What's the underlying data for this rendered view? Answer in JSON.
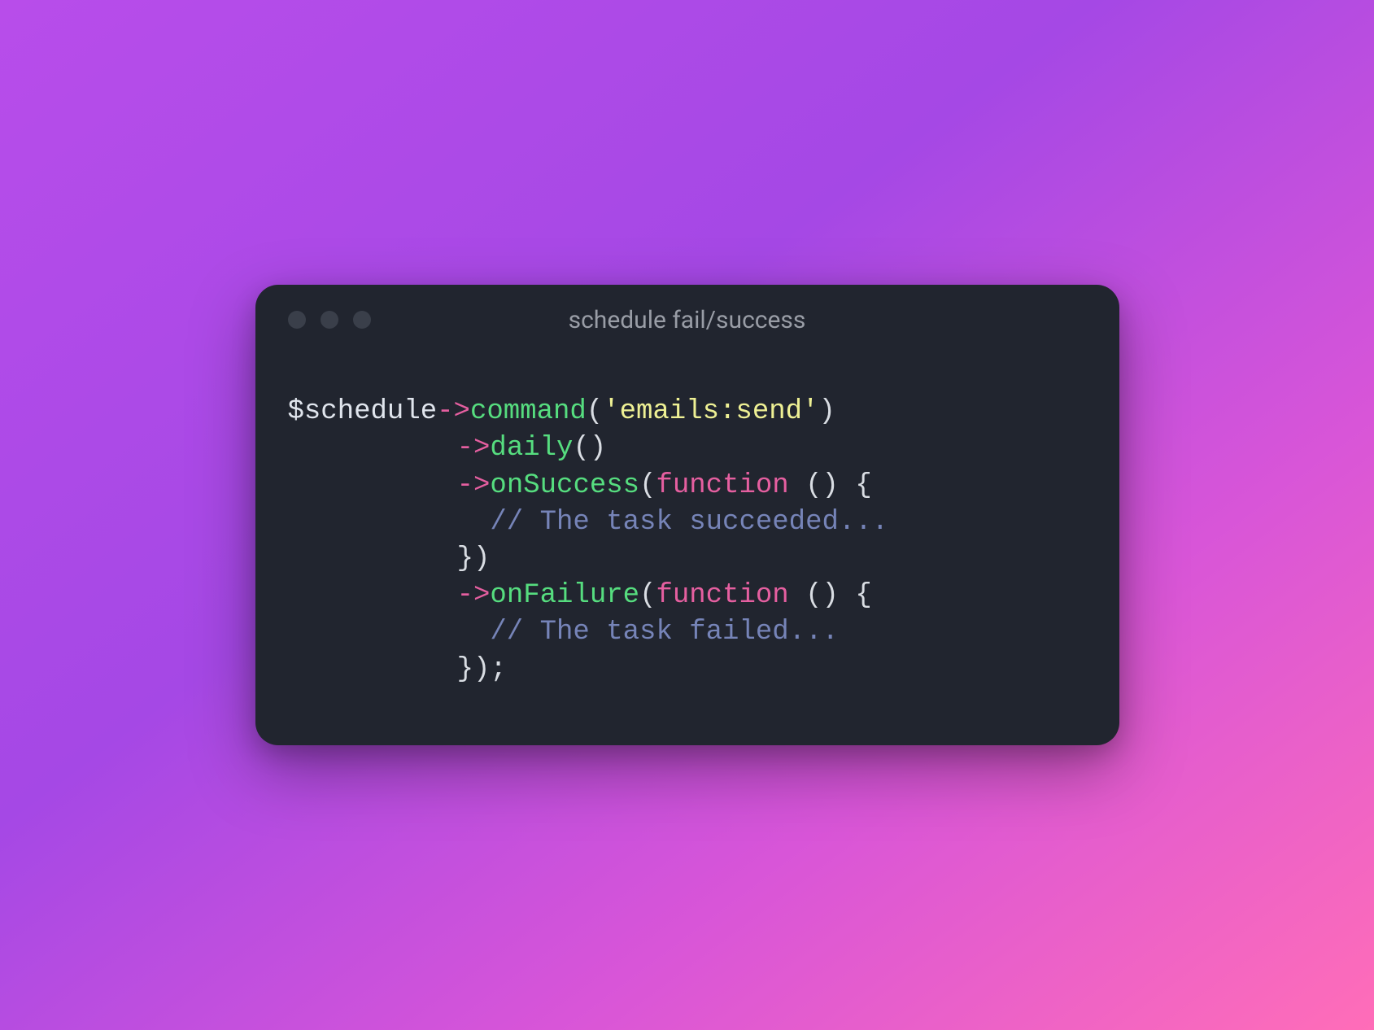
{
  "window": {
    "title": "schedule fail/success"
  },
  "code": {
    "line1": {
      "var": "$schedule",
      "arrow": "->",
      "method": "command",
      "open": "(",
      "string": "'emails:send'",
      "close": ")"
    },
    "line2": {
      "arrow": "->",
      "method": "daily",
      "parens": "()"
    },
    "line3": {
      "arrow": "->",
      "method": "onSuccess",
      "open": "(",
      "keyword": "function",
      "rest": " () {"
    },
    "line4": {
      "comment": "// The task succeeded..."
    },
    "line5": {
      "text": "})"
    },
    "line6": {
      "arrow": "->",
      "method": "onFailure",
      "open": "(",
      "keyword": "function",
      "rest": " () {"
    },
    "line7": {
      "comment": "// The task failed..."
    },
    "line8": {
      "text": "});"
    }
  }
}
